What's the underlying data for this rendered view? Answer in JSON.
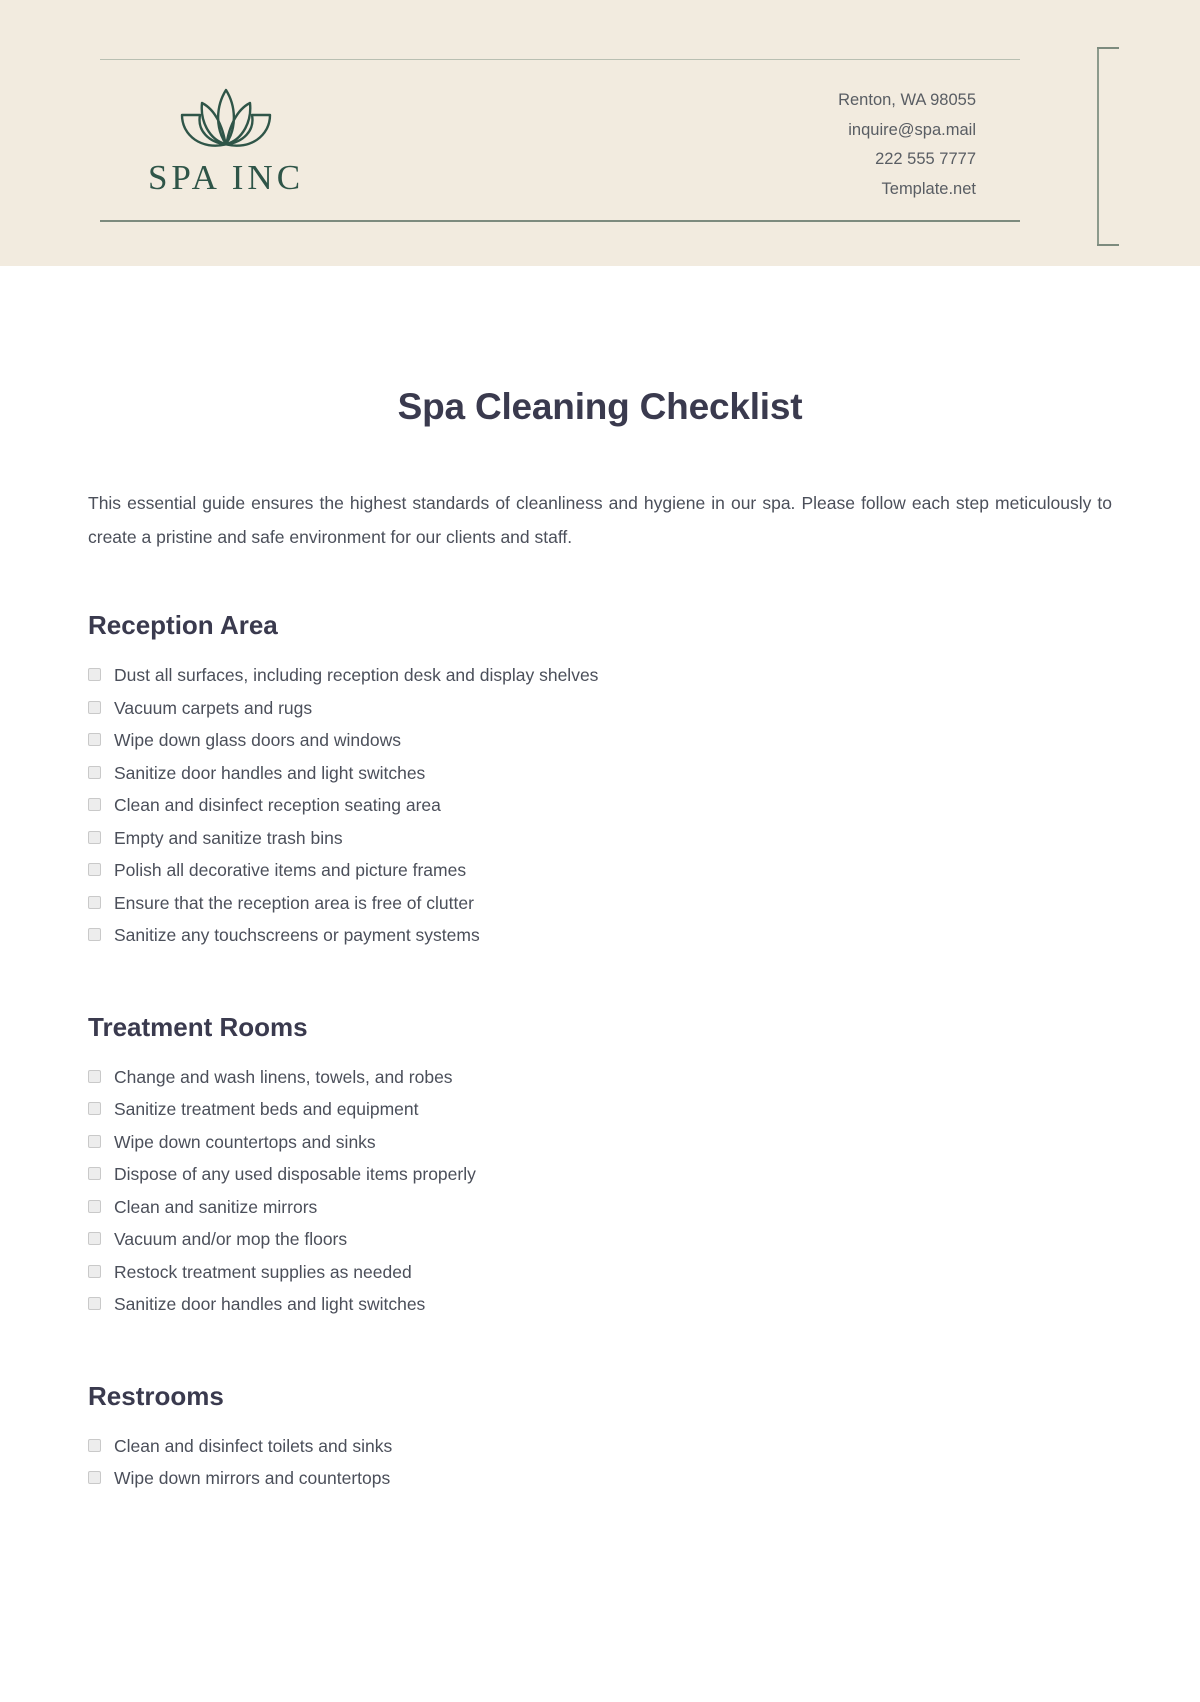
{
  "header": {
    "logo": {
      "icon": "lotus-flower-icon",
      "name": "SPA INC",
      "color": "#2F5548"
    },
    "contact": [
      "Renton, WA 98055",
      "inquire@spa.mail",
      "222 555 7777",
      "Template.net"
    ],
    "background_color": "#F2EBDF"
  },
  "document": {
    "title": "Spa Cleaning Checklist",
    "intro": "This essential guide ensures the highest standards of cleanliness and hygiene in our spa. Please follow each step meticulously to create a pristine and safe environment for our clients and staff.",
    "sections": [
      {
        "title": "Reception Area",
        "items": [
          "Dust all surfaces, including reception desk and display shelves",
          "Vacuum carpets and rugs",
          "Wipe down glass doors and windows",
          "Sanitize door handles and light switches",
          "Clean and disinfect reception seating area",
          "Empty and sanitize trash bins",
          "Polish all decorative items and picture frames",
          "Ensure that the reception area is free of clutter",
          "Sanitize any touchscreens or payment systems"
        ]
      },
      {
        "title": "Treatment Rooms",
        "items": [
          "Change and wash linens, towels, and robes",
          "Sanitize treatment beds and equipment",
          "Wipe down countertops and sinks",
          "Dispose of any used disposable items properly",
          "Clean and sanitize mirrors",
          "Vacuum and/or mop the floors",
          "Restock treatment supplies as needed",
          "Sanitize door handles and light switches"
        ]
      },
      {
        "title": "Restrooms",
        "items": [
          "Clean and disinfect toilets and sinks",
          "Wipe down mirrors and countertops"
        ]
      }
    ]
  }
}
